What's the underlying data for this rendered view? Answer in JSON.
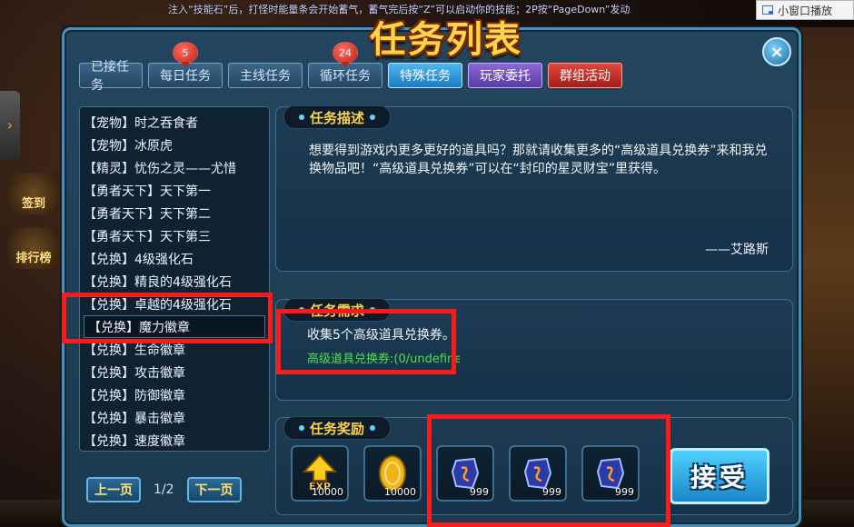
{
  "top_hint": "注入“技能石”后，打怪时能量条会开始蓄气，蓄气完后按“Z”可以启动你的技能；2P按“PageDown”发动",
  "mini_window": {
    "label": "小窗口播放"
  },
  "side_decorations": {
    "sign_in": "签到",
    "ranking": "排行榜"
  },
  "dialog": {
    "title": "任务列表",
    "close_label": "×"
  },
  "tabs": [
    {
      "label": "已接任务",
      "badge": ""
    },
    {
      "label": "每日任务",
      "badge": "5"
    },
    {
      "label": "主线任务",
      "badge": ""
    },
    {
      "label": "循环任务",
      "badge": "24"
    },
    {
      "label": "特殊任务",
      "badge": ""
    },
    {
      "label": "玩家委托",
      "badge": ""
    },
    {
      "label": "群组活动",
      "badge": ""
    }
  ],
  "quest_list": [
    "【宠物】时之吞食者",
    "【宠物】冰原虎",
    "【精灵】忧伤之灵——尤惜",
    "【勇者天下】天下第一",
    "【勇者天下】天下第二",
    "【勇者天下】天下第三",
    "【兑换】4级强化石",
    "【兑换】精良的4级强化石",
    "【兑换】卓越的4级强化石",
    "【兑换】魔力徽章",
    "【兑换】生命徽章",
    "【兑换】攻击徽章",
    "【兑换】防御徽章",
    "【兑换】暴击徽章",
    "【兑换】速度徽章"
  ],
  "pager": {
    "prev": "上一页",
    "page": "1/2",
    "next": "下一页"
  },
  "description": {
    "title": "任务描述",
    "text": "想要得到游戏内更多更好的道具吗？那就请收集更多的“高级道具兑换券”来和我兑换物品吧！“高级道具兑换券”可以在“封印的星灵财宝”里获得。",
    "signature": "——艾路斯"
  },
  "requirement": {
    "title": "任务需求",
    "text": "收集5个高级道具兑换券。",
    "progress": "高级道具兑换券:(0/undefined)"
  },
  "rewards": {
    "title": "任务奖励",
    "items": [
      {
        "icon": "exp-arrow-icon",
        "qty": "10000"
      },
      {
        "icon": "gold-coin-icon",
        "qty": "10000"
      },
      {
        "icon": "rune-stone-icon",
        "qty": "999"
      },
      {
        "icon": "rune-stone-icon",
        "qty": "999"
      },
      {
        "icon": "rune-stone-icon",
        "qty": "999"
      }
    ]
  },
  "accept_label": "接受",
  "colors": {
    "highlight_box": "#ff1a1a",
    "progress_text": "#48e34a",
    "title_gold": "#ffd54a"
  }
}
